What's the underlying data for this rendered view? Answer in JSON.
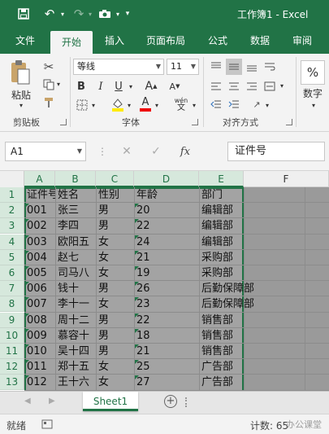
{
  "window": {
    "title": "工作簿1 - Excel"
  },
  "tabs": [
    {
      "label": "文件"
    },
    {
      "label": "开始"
    },
    {
      "label": "插入"
    },
    {
      "label": "页面布局"
    },
    {
      "label": "公式"
    },
    {
      "label": "数据"
    },
    {
      "label": "审阅"
    }
  ],
  "ribbon": {
    "clipboard": {
      "paste_label": "粘贴",
      "group_label": "剪贴板"
    },
    "font": {
      "font_name": "等线",
      "font_size": "11",
      "bold": "B",
      "italic": "I",
      "underline": "U",
      "grow": "A",
      "shrink": "A",
      "font_color_letter": "A",
      "phonetic": "wén",
      "group_label": "字体"
    },
    "alignment": {
      "group_label": "对齐方式"
    },
    "number": {
      "percent": "%",
      "label": "数字"
    }
  },
  "formula_bar": {
    "name_box": "A1",
    "fx": "fx",
    "content": "证件号"
  },
  "grid": {
    "columns": [
      "A",
      "B",
      "C",
      "D",
      "E",
      "F"
    ],
    "rows": [
      "1",
      "2",
      "3",
      "4",
      "5",
      "6",
      "7",
      "8",
      "9",
      "10",
      "11",
      "12",
      "13"
    ],
    "data": [
      [
        "证件号",
        "姓名",
        "性别",
        "年龄",
        "部门"
      ],
      [
        "001",
        "张三",
        "男",
        "20",
        "编辑部"
      ],
      [
        "002",
        "李四",
        "男",
        "22",
        "编辑部"
      ],
      [
        "003",
        "欧阳五",
        "女",
        "24",
        "编辑部"
      ],
      [
        "004",
        "赵七",
        "女",
        "21",
        "采购部"
      ],
      [
        "005",
        "司马八",
        "女",
        "19",
        "采购部"
      ],
      [
        "006",
        "钱十",
        "男",
        "26",
        "后勤保障部"
      ],
      [
        "007",
        "李十一",
        "女",
        "23",
        "后勤保障部"
      ],
      [
        "008",
        "周十二",
        "男",
        "22",
        "销售部"
      ],
      [
        "009",
        "慕容十",
        "男",
        "18",
        "销售部"
      ],
      [
        "010",
        "吴十四",
        "男",
        "21",
        "销售部"
      ],
      [
        "011",
        "郑十五",
        "女",
        "25",
        "广告部"
      ],
      [
        "012",
        "王十六",
        "女",
        "27",
        "广告部"
      ]
    ]
  },
  "sheets": [
    {
      "label": "Sheet1"
    }
  ],
  "status": {
    "ready": "就绪",
    "count": "计数: 65",
    "watermark": "办公课堂"
  },
  "colors": {
    "accent": "#217346",
    "selection_header": "#d6e8dc"
  }
}
